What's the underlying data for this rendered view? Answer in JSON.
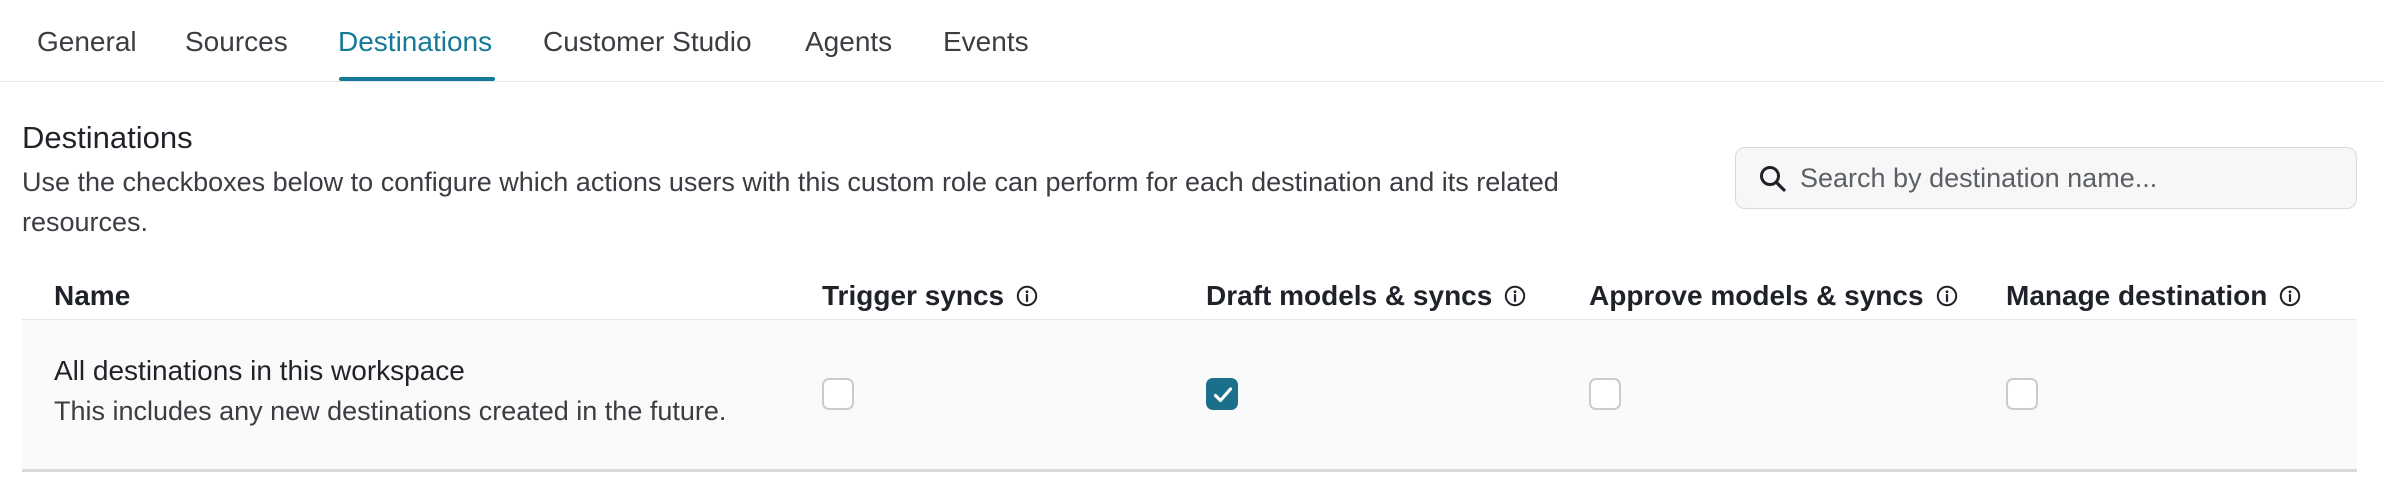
{
  "tabs": [
    {
      "label": "General",
      "active": false
    },
    {
      "label": "Sources",
      "active": false
    },
    {
      "label": "Destinations",
      "active": true
    },
    {
      "label": "Customer Studio",
      "active": false
    },
    {
      "label": "Agents",
      "active": false
    },
    {
      "label": "Events",
      "active": false
    }
  ],
  "section": {
    "title": "Destinations",
    "description": "Use the checkboxes below to configure which actions users with this custom role can perform for each destination and its related resources."
  },
  "search": {
    "placeholder": "Search by destination name...",
    "value": "",
    "icon": "search-icon"
  },
  "table": {
    "columns": [
      {
        "label": "Name",
        "info": false
      },
      {
        "label": "Trigger syncs",
        "info": true
      },
      {
        "label": "Draft models & syncs",
        "info": true
      },
      {
        "label": "Approve models & syncs",
        "info": true
      },
      {
        "label": "Manage destination",
        "info": true
      }
    ],
    "rows": [
      {
        "title": "All destinations in this workspace",
        "subtitle": "This includes any new destinations created in the future.",
        "permissions": {
          "trigger_syncs": false,
          "draft_models_syncs": true,
          "approve_models_syncs": false,
          "manage_destination": false
        }
      }
    ]
  },
  "colors": {
    "accent": "#157a98",
    "checkbox_checked": "#1a6f8a"
  }
}
